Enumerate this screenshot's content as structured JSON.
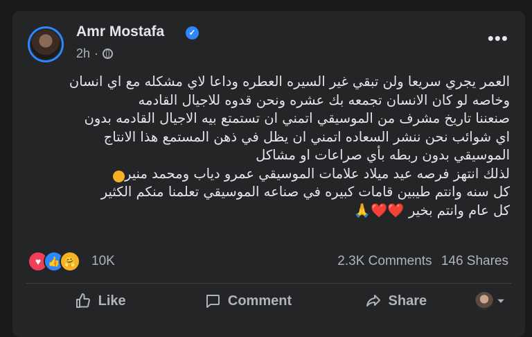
{
  "post": {
    "author": "Amr Mostafa",
    "time": "2h",
    "more_label": "•••",
    "verified_icon": "✓",
    "text_lines": [
      "العمر يجري سريعا ولن تبقي غير السيره العطره وداعا لاي مشكله مع اي انسان",
      "وخاصه لو  كان الانسان تجمعه بك عشره ونحن قدوه للاجيال القادمه",
      "صنعننا تاريخ مشرف من الموسيقي اتمني ان تستمتع بيه الاجيال القادمه بدون",
      "اي شوائب نحن ننشر السعاده  اتمني ان يظل في ذهن المستمع هذا الانتاج",
      "الموسيقي بدون ربطه بأي صراعات او مشاكل",
      "لذلك انتهز فرصه عيد ميلاد  علامات الموسيقي  عمرو دياب ومحمد منير",
      "كل سنه وانتم طيبين قامات كبيره في صناعه الموسيقي  تعلمنا منكم الكثير",
      "كل عام وانتم بخير ❤️❤️🙏"
    ]
  },
  "reactions": {
    "icons": [
      "love",
      "like",
      "care"
    ],
    "count": "10K"
  },
  "stats": {
    "comments": "2.3K Comments",
    "shares": "146 Shares"
  },
  "actions": {
    "like": "Like",
    "comment": "Comment",
    "share": "Share"
  },
  "colors": {
    "background": "#18191a",
    "card": "#242526",
    "text": "#e4e6eb",
    "secondary_text": "#b0b3b8",
    "accent": "#2d88ff",
    "love": "#f33e58"
  }
}
